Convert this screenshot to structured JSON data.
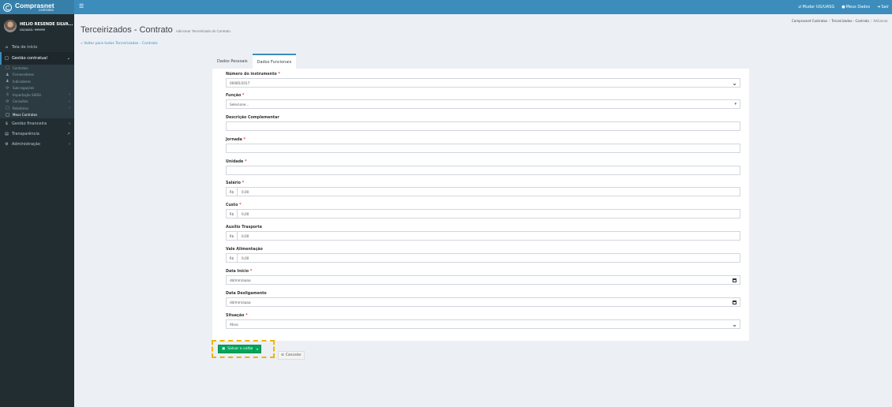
{
  "brand": {
    "name": "Comprasnet",
    "sub": "contratos"
  },
  "nav": {
    "menu_icon": "hamburger-icon",
    "mudar": "Mudar UG/UASG",
    "meus_dados": "Meus Dados",
    "sair": "Sair"
  },
  "user": {
    "name": "HELIO RESENDE SILVA...",
    "uasg": "UG/UASG: 999999"
  },
  "sidebar": {
    "tela_inicio": "Tela de início",
    "gestao_contratual": "Gestão contratual",
    "sub": [
      "Contratos",
      "Fornecedores",
      "Indicadores",
      "Sub-rogações",
      "Importação SIASG",
      "Consultas",
      "Relatórios",
      "Meus Contratos"
    ],
    "gestao_financeira": "Gestão financeira",
    "transparencia": "Transparência",
    "administracao": "Administração"
  },
  "page": {
    "title": "Terceirizados - Contrato",
    "subtitle": "Adicionar Terceirizado do Contrato.",
    "back": "Voltar para todos Terceirizados - Contrato"
  },
  "breadcrumb": [
    "Comprasnet Contratos",
    "Terceirizados - Contrato",
    "Adicionar"
  ],
  "tabs": [
    "Dados Pessoais",
    "Dados Funcionais"
  ],
  "form": {
    "numero_label": "Número do instrumento",
    "numero_value": "00085/2017",
    "funcao_label": "Função",
    "funcao_value": "Selecione...",
    "descricao_label": "Descrição Complementar",
    "jornada_label": "Jornada",
    "unidade_label": "Unidade",
    "salario_label": "Salário",
    "custo_label": "Custo",
    "auxilio_label": "Auxílio Trasporte",
    "vale_label": "Vale Alimentação",
    "currency": "R$",
    "money_placeholder": "0,00",
    "data_inicio_label": "Data Início",
    "data_desligamento_label": "Data Desligamento",
    "date_placeholder": "dd/mm/aaaa",
    "situacao_label": "Situação",
    "situacao_value": "Ativo",
    "required_mark": "*"
  },
  "actions": {
    "save": "Salvar e voltar",
    "cancel": "Cancelar"
  },
  "colors": {
    "primary": "#3c8dbc",
    "sidebar": "#222d32",
    "success": "#00a65a",
    "highlight": "#f0b400"
  }
}
